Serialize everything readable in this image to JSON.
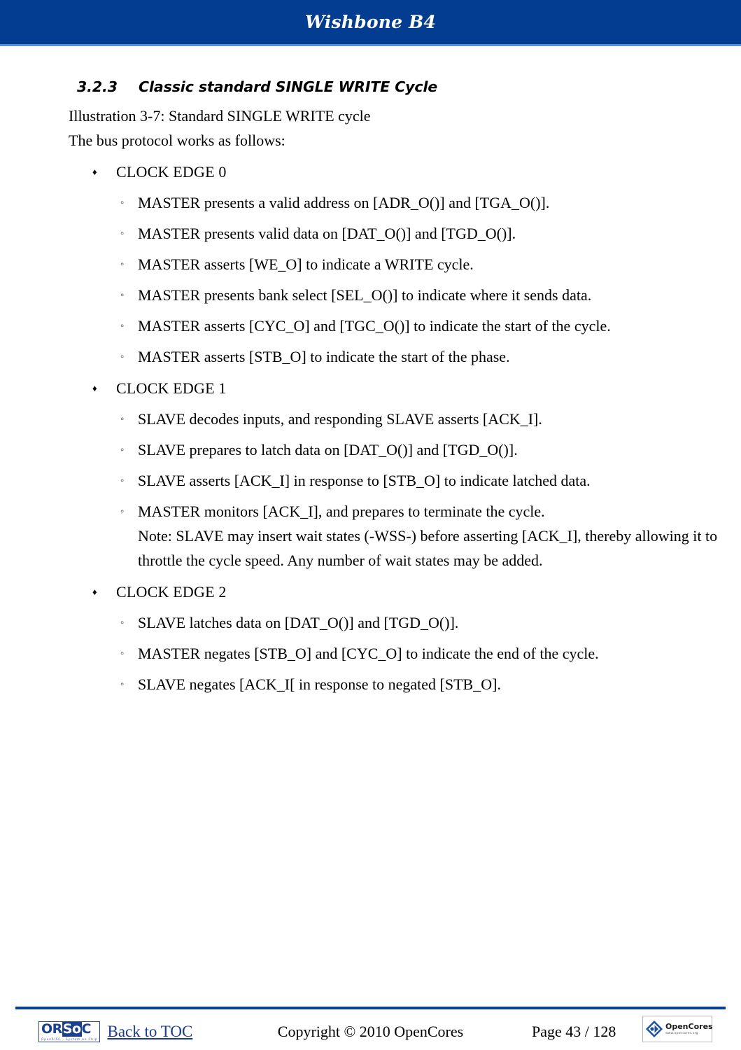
{
  "header": {
    "title": "Wishbone B4"
  },
  "section": {
    "number": "3.2.3",
    "title": "Classic standard SINGLE WRITE Cycle",
    "illustration": "Illustration 3-7: Standard SINGLE WRITE cycle",
    "intro": "The bus protocol works as follows:"
  },
  "bullets": {
    "diamond": "♦",
    "circle": "◦"
  },
  "groups": [
    {
      "label": "CLOCK EDGE 0",
      "items": [
        {
          "text": "MASTER presents a valid address on [ADR_O()] and [TGA_O()]."
        },
        {
          "text": "MASTER presents valid data on [DAT_O()] and [TGD_O()]."
        },
        {
          "text": "MASTER asserts [WE_O] to indicate a WRITE cycle."
        },
        {
          "text": "MASTER presents bank select [SEL_O()] to indicate where it sends data."
        },
        {
          "text": "MASTER asserts [CYC_O] and [TGC_O()] to indicate the start of the cycle."
        },
        {
          "text": "MASTER asserts [STB_O] to indicate the start of the phase."
        }
      ]
    },
    {
      "label": "CLOCK EDGE 1",
      "items": [
        {
          "text": "SLAVE decodes inputs, and responding SLAVE asserts [ACK_I]."
        },
        {
          "text": "SLAVE prepares to latch data on [DAT_O()] and [TGD_O()]."
        },
        {
          "text": "SLAVE asserts [ACK_I] in response to [STB_O] to indicate latched data."
        },
        {
          "text": "MASTER monitors [ACK_I], and prepares to terminate the cycle.",
          "extra_lines": [
            "Note: SLAVE may insert wait states (-WSS-) before asserting [ACK_I], thereby",
            "allowing it to throttle the cycle speed.  Any number of wait states may be added."
          ]
        }
      ]
    },
    {
      "label": "CLOCK EDGE 2",
      "items": [
        {
          "text": "SLAVE latches data on [DAT_O()] and [TGD_O()]."
        },
        {
          "text": "MASTER negates [STB_O] and [CYC_O] to indicate the end of the cycle."
        },
        {
          "text": "SLAVE negates [ACK_I[ in response to negated [STB_O]."
        }
      ]
    }
  ],
  "footer": {
    "orsoc_logo": {
      "part1": "OR",
      "part2": "So",
      "part3": "C",
      "subtitle": "OpenRISC - System on Chip"
    },
    "toc_link": "Back to TOC",
    "copyright": "Copyright © 2010 OpenCores",
    "page": "Page 43 / 128",
    "opencores_logo": {
      "name": "OpenCores",
      "url": "www.opencores.org"
    }
  },
  "colors": {
    "header_blue": "#033d91",
    "rule_blue": "#0b3f8f",
    "link_blue": "#1a3a8f"
  }
}
